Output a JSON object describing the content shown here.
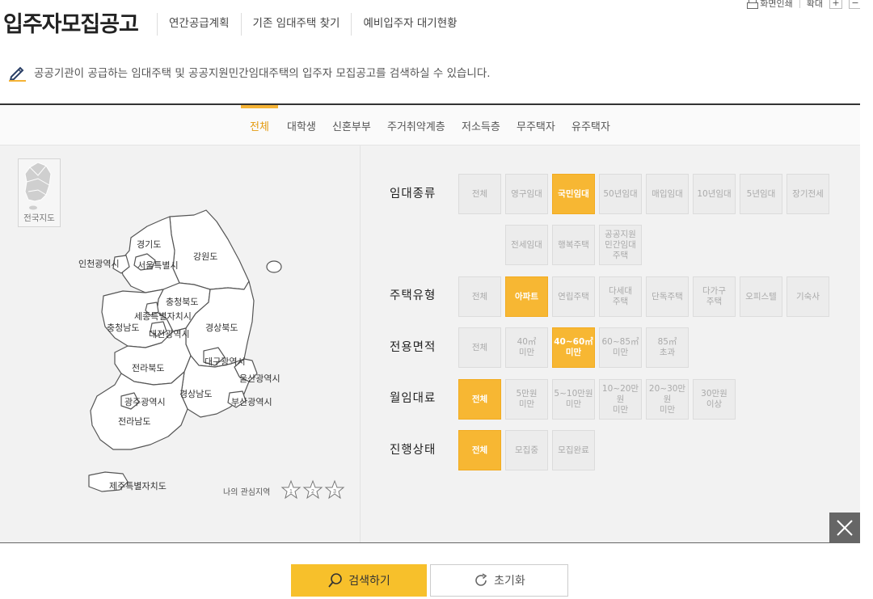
{
  "util": {
    "print_label": "화면인쇄",
    "zoom_label": "확대",
    "zoom_in": "+",
    "zoom_out": "−"
  },
  "header": {
    "title": "입주자모집공고",
    "nav": [
      "연간공급계획",
      "기존 임대주택 찾기",
      "예비입주자 대기현황"
    ]
  },
  "description": "공공기관이 공급하는 임대주택 및 공공지원민간임대주택의 입주자 모집공고를 검색하실 수 있습니다.",
  "tabs": [
    {
      "label": "전체",
      "active": true
    },
    {
      "label": "대학생"
    },
    {
      "label": "신혼부부"
    },
    {
      "label": "주거취약계층"
    },
    {
      "label": "저소득층"
    },
    {
      "label": "무주택자"
    },
    {
      "label": "유주택자"
    }
  ],
  "map": {
    "nation_label": "전국지도",
    "regions": [
      "경기도",
      "인천광역시",
      "서울특별시",
      "강원도",
      "충청북도",
      "세종특별자치시",
      "충청남도",
      "대전광역시",
      "경상북도",
      "대구광역시",
      "전라북도",
      "울산광역시",
      "경상남도",
      "광주광역시",
      "부산광역시",
      "전라남도",
      "제주특별자치도"
    ],
    "my_area_label": "나의 관심지역",
    "star_numbers": [
      "1",
      "2",
      "3"
    ]
  },
  "filters": {
    "rental_type": {
      "label": "임대종류",
      "options": [
        "전체",
        "영구임대",
        "국민임대",
        "50년임대",
        "매입임대",
        "10년임대",
        "5년임대",
        "장기전세",
        "전세임대",
        "행복주택",
        "공공지원\n민간임대\n주택"
      ],
      "selected": "국민임대"
    },
    "housing_type": {
      "label": "주택유형",
      "options": [
        "전체",
        "아파트",
        "연립주택",
        "다세대\n주택",
        "단독주택",
        "다가구\n주택",
        "오피스텔",
        "기숙사"
      ],
      "selected": "아파트"
    },
    "area": {
      "label": "전용면적",
      "options": [
        "전체",
        "40㎡\n미만",
        "40~60㎡\n미만",
        "60~85㎡\n미만",
        "85㎡\n초과"
      ],
      "selected": "40~60㎡ 미만"
    },
    "rent": {
      "label": "월임대료",
      "options": [
        "전체",
        "5만원\n미만",
        "5~10만원\n미만",
        "10~20만원\n미만",
        "20~30만원\n미만",
        "30만원\n이상"
      ],
      "selected": "전체"
    },
    "status": {
      "label": "진행상태",
      "options": [
        "전체",
        "모집중",
        "모집완료"
      ],
      "selected": "전체"
    }
  },
  "actions": {
    "search_label": "검색하기",
    "reset_label": "초기화"
  },
  "colors": {
    "accent": "#f7b733",
    "tab_active": "#e49b10",
    "panel_bg": "#f2f2f2"
  }
}
